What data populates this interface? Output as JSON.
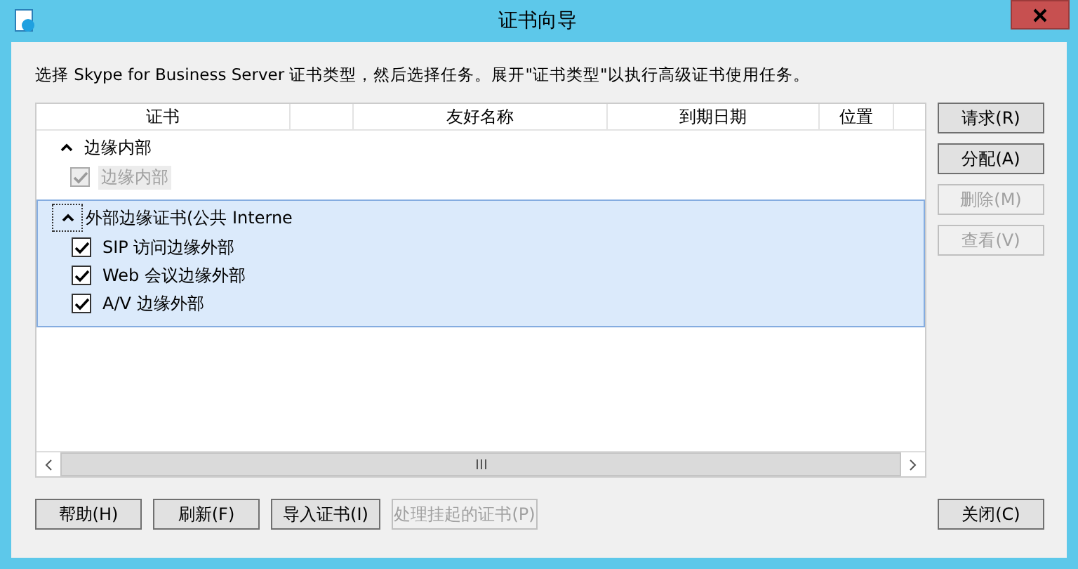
{
  "window": {
    "title": "证书向导"
  },
  "description": "选择 Skype for Business Server 证书类型，然后选择任务。展开\"证书类型\"以执行高级证书使用任务。",
  "table": {
    "columns": [
      "证书",
      "",
      "友好名称",
      "到期日期",
      "位置"
    ],
    "groups": [
      {
        "label": "边缘内部",
        "expanded": true,
        "selected": false,
        "children": [
          {
            "label": "边缘内部",
            "checked": true,
            "disabled": true
          }
        ]
      },
      {
        "label": "外部边缘证书(公共 Interne",
        "expanded": true,
        "selected": true,
        "children": [
          {
            "label": "SIP 访问边缘外部",
            "checked": true,
            "disabled": false
          },
          {
            "label": "Web 会议边缘外部",
            "checked": true,
            "disabled": false
          },
          {
            "label": "A/V 边缘外部",
            "checked": true,
            "disabled": false
          }
        ]
      }
    ]
  },
  "side_buttons": [
    {
      "label": "请求(R)",
      "disabled": false
    },
    {
      "label": "分配(A)",
      "disabled": false
    },
    {
      "label": "删除(M)",
      "disabled": true
    },
    {
      "label": "查看(V)",
      "disabled": true
    }
  ],
  "bottom_buttons": [
    {
      "label": "帮助(H)",
      "disabled": false
    },
    {
      "label": "刷新(F)",
      "disabled": false
    },
    {
      "label": "导入证书(I)",
      "disabled": false
    },
    {
      "label": "处理挂起的证书(P)",
      "disabled": true
    }
  ],
  "close_button": {
    "label": "关闭(C)",
    "disabled": false
  }
}
